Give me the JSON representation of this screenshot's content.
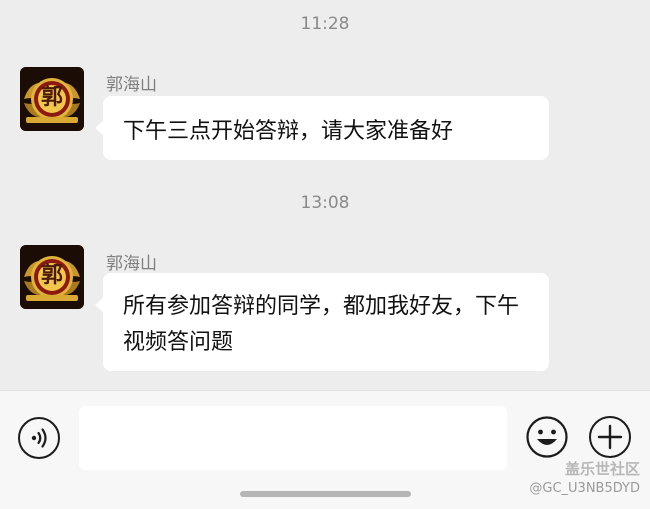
{
  "messages": [
    {
      "timestamp": "11:28",
      "sender": "郭海山",
      "avatar_char": "郭",
      "text": "下午三点开始答辩，请大家准备好"
    },
    {
      "timestamp": "13:08",
      "sender": "郭海山",
      "avatar_char": "郭",
      "text": "所有参加答辩的同学，都加我好友，下午视频答问题"
    }
  ],
  "input": {
    "value": "",
    "placeholder": ""
  },
  "icons": {
    "voice": "voice-icon",
    "emoji": "emoji-icon",
    "plus": "plus-icon"
  },
  "watermark": {
    "site": "盖乐世社区",
    "handle": "@GC_U3NB5DYD"
  },
  "colors": {
    "chat_background": "#ededed",
    "bubble": "#ffffff",
    "bottom_bar": "#f7f7f7",
    "avatar_gold": "#e0b43a",
    "avatar_red": "#8c1a12"
  }
}
